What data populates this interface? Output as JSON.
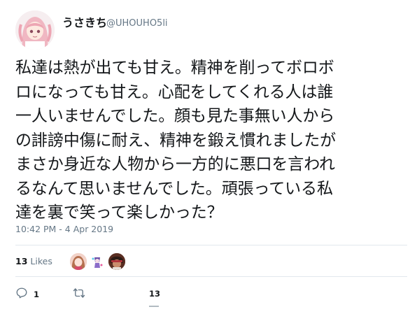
{
  "tweet": {
    "display_name": "うさきち",
    "handle": "@UHOUHO5li",
    "text_lines": [
      "私達は熱が出ても甘え。精神を削ってボロボ",
      "ロになっても甘え。心配をしてくれる人は誰",
      "一人いませんでした。顔も見た事無い人から",
      "の誹謗中傷に耐え、精神を鍛え慣れましたが",
      "まさか身近な人物から一方的に悪口を言われ",
      "るなんて思いませんでした。頑張っている私",
      "達を裏で笑って楽しかった？"
    ],
    "timestamp": "10:42 PM - 4 Apr 2019"
  },
  "stats": {
    "likes_count": "13",
    "likes_label": "Likes"
  },
  "actions": {
    "reply_count": "1",
    "like_count": "13"
  },
  "icons": {
    "reply": "reply-icon",
    "retweet": "retweet-icon"
  },
  "colors": {
    "text": "#14171a",
    "secondary": "#657786",
    "divider": "#e1e8ed"
  }
}
